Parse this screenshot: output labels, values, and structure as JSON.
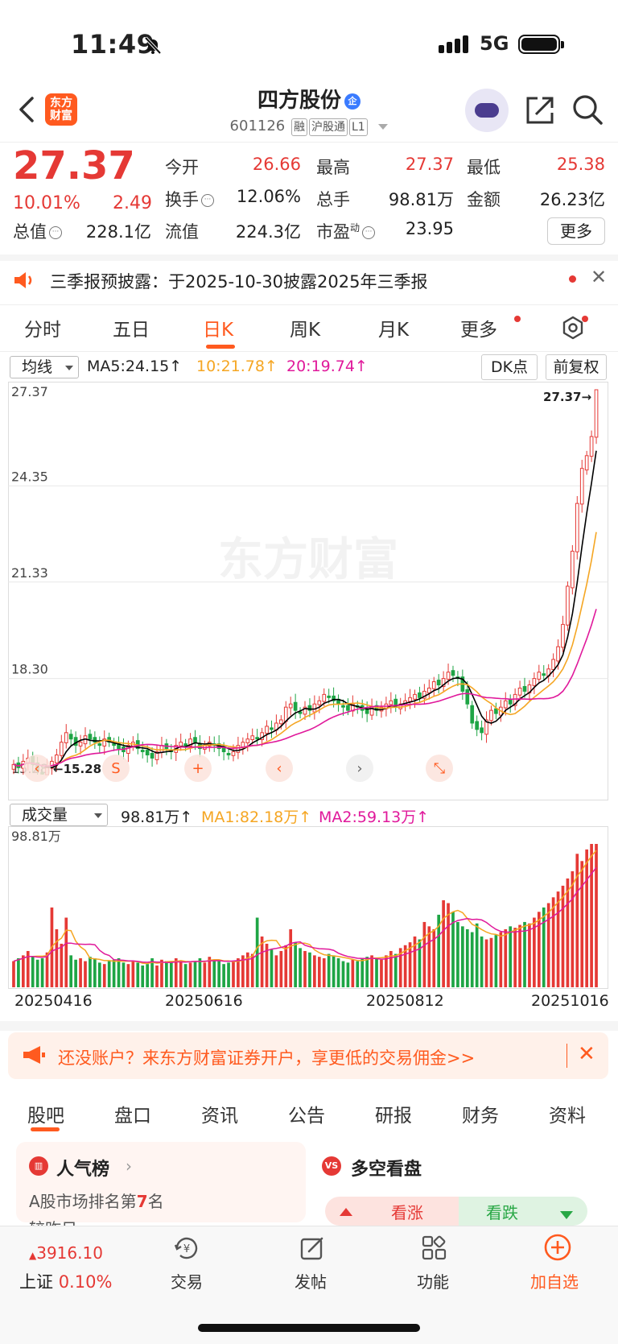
{
  "status": {
    "time": "11:49",
    "network": "5G"
  },
  "header": {
    "logo_line1": "东方",
    "logo_line2": "财富",
    "title": "四方股份",
    "badge": "企",
    "code": "601126",
    "tags": [
      "融",
      "沪股通",
      "L1"
    ]
  },
  "quote": {
    "price": "27.37",
    "change_pct": "10.01%",
    "change": "2.49",
    "labels": {
      "open": "今开",
      "high": "最高",
      "low": "最低",
      "turnover": "换手",
      "volume": "总手",
      "amount": "金额",
      "mktcap": "总值",
      "float": "流值",
      "pe": "市盈",
      "pe_sup": "动"
    },
    "values": {
      "open": "26.66",
      "high": "27.37",
      "low": "25.38",
      "turnover": "12.06%",
      "volume": "98.81万",
      "amount": "26.23亿",
      "mktcap": "228.1亿",
      "float": "224.3亿",
      "pe": "23.95"
    },
    "more": "更多"
  },
  "notice": {
    "text": "三季报预披露：于2025-10-30披露2025年三季报"
  },
  "tabs": [
    "分时",
    "五日",
    "日K",
    "周K",
    "月K",
    "更多"
  ],
  "ma": {
    "selector": "均线",
    "ma5": "MA5:24.15↑",
    "ma10": "10:21.78↑",
    "ma20": "20:19.74↑",
    "dk": "DK点",
    "adjust": "前复权",
    "colors": {
      "ma5": "#000000",
      "ma10": "#f5a623",
      "ma20": "#e0199b"
    }
  },
  "chart_data": {
    "type": "candlestick",
    "y_ticks": [
      "27.37",
      "24.35",
      "21.33",
      "18.30",
      "15.28"
    ],
    "ylim": [
      15.28,
      27.37
    ],
    "last_label": "27.37→",
    "low_label": "←15.28",
    "watermark": "东方财富",
    "dates": [
      "20250416",
      "20250616",
      "20250812",
      "20251016"
    ],
    "closes": [
      15.6,
      15.5,
      15.7,
      15.8,
      15.6,
      15.4,
      15.3,
      15.5,
      15.7,
      15.9,
      16.3,
      16.6,
      16.4,
      16.2,
      16.3,
      16.5,
      16.4,
      16.3,
      16.2,
      16.4,
      16.3,
      16.2,
      16.1,
      16.0,
      16.2,
      16.3,
      16.1,
      16.0,
      15.9,
      15.8,
      16.0,
      16.2,
      16.1,
      16.0,
      16.2,
      16.3,
      16.2,
      16.4,
      16.3,
      16.1,
      16.2,
      16.3,
      16.2,
      16.1,
      16.0,
      15.9,
      16.0,
      16.2,
      16.3,
      16.4,
      16.5,
      16.4,
      16.6,
      16.8,
      16.7,
      16.9,
      17.0,
      17.4,
      17.5,
      17.3,
      17.2,
      17.4,
      17.3,
      17.5,
      17.6,
      17.8,
      17.7,
      17.6,
      17.5,
      17.4,
      17.3,
      17.5,
      17.4,
      17.3,
      17.2,
      17.4,
      17.3,
      17.4,
      17.5,
      17.6,
      17.4,
      17.5,
      17.6,
      17.7,
      17.8,
      17.7,
      17.9,
      18.0,
      18.2,
      18.1,
      18.3,
      18.5,
      18.4,
      18.3,
      17.9,
      17.5,
      16.9,
      16.7,
      16.6,
      17.0,
      17.3,
      17.2,
      17.4,
      17.6,
      17.5,
      17.8,
      18.0,
      17.9,
      18.1,
      18.3,
      18.5,
      18.4,
      18.6,
      18.9,
      19.3,
      20.0,
      21.2,
      22.3,
      23.8,
      24.9,
      25.3,
      25.9,
      27.37
    ],
    "volumes_wan": [
      18,
      20,
      22,
      25,
      21,
      19,
      20,
      24,
      55,
      40,
      30,
      48,
      22,
      19,
      20,
      18,
      21,
      20,
      17,
      16,
      18,
      19,
      20,
      17,
      16,
      18,
      17,
      15,
      16,
      20,
      15,
      19,
      18,
      17,
      20,
      18,
      16,
      17,
      18,
      20,
      17,
      21,
      19,
      18,
      16,
      17,
      18,
      20,
      22,
      24,
      23,
      48,
      35,
      30,
      26,
      22,
      25,
      29,
      40,
      31,
      27,
      25,
      24,
      22,
      21,
      20,
      23,
      22,
      20,
      18,
      17,
      19,
      18,
      20,
      21,
      22,
      20,
      19,
      22,
      25,
      23,
      27,
      29,
      31,
      35,
      33,
      45,
      42,
      40,
      50,
      60,
      58,
      52,
      45,
      42,
      40,
      38,
      44,
      35,
      33,
      34,
      36,
      38,
      40,
      42,
      41,
      43,
      45,
      44,
      48,
      52,
      55,
      58,
      62,
      66,
      70,
      75,
      80,
      92,
      87,
      95,
      98.81,
      98.81
    ],
    "volume_max_label": "98.81万",
    "volume_bar": {
      "selector": "成交量",
      "vol": "98.81万↑",
      "ma1": "MA1:82.18万↑",
      "ma2": "MA2:59.13万↑"
    }
  },
  "promo": {
    "text": "还没账户？来东方财富证券开户，享更低的交易佣金>>"
  },
  "bottom_tabs": [
    "股吧",
    "盘口",
    "资讯",
    "公告",
    "研报",
    "财务",
    "资料"
  ],
  "cards": {
    "popularity": {
      "title": "人气榜",
      "rank_prefix": "A股市场排名第",
      "rank": "7",
      "rank_suffix": "名",
      "sub": "较昨日"
    },
    "bullbear": {
      "title": "多空看盘",
      "up": "看涨",
      "down": "看跌"
    }
  },
  "bottom_nav": {
    "index_value": "3916.10",
    "index_name": "上证",
    "index_pct": "0.10%",
    "trade": "交易",
    "post": "发帖",
    "function": "功能",
    "add": "加自选"
  }
}
